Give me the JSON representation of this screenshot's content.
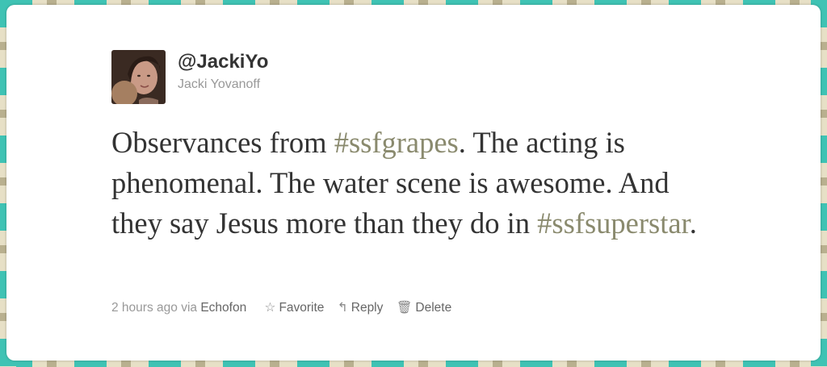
{
  "user": {
    "handle": "@JackiYo",
    "name": "Jacki Yovanoff",
    "avatar_icon": "profile-photo"
  },
  "tweet": {
    "part1": "Observances from ",
    "hashtag1": "#ssfgrapes",
    "part2": ". The acting is phenomenal. The water scene is awesome. And they say Jesus more than they do in ",
    "hashtag2": "#ssfsuperstar",
    "part3": "."
  },
  "meta": {
    "time": "2 hours ago",
    "via": "via",
    "source": "Echofon"
  },
  "actions": [
    {
      "label": "Favorite",
      "icon": "star-outline-icon"
    },
    {
      "label": "Reply",
      "icon": "reply-arrow-icon"
    },
    {
      "label": "Delete",
      "icon": "trash-icon"
    }
  ],
  "colors": {
    "frame_teal": "#3fc3b4",
    "frame_beige": "#e7e0c6",
    "hashtag": "#8a8a6e",
    "text": "#333333",
    "muted": "#999999"
  }
}
